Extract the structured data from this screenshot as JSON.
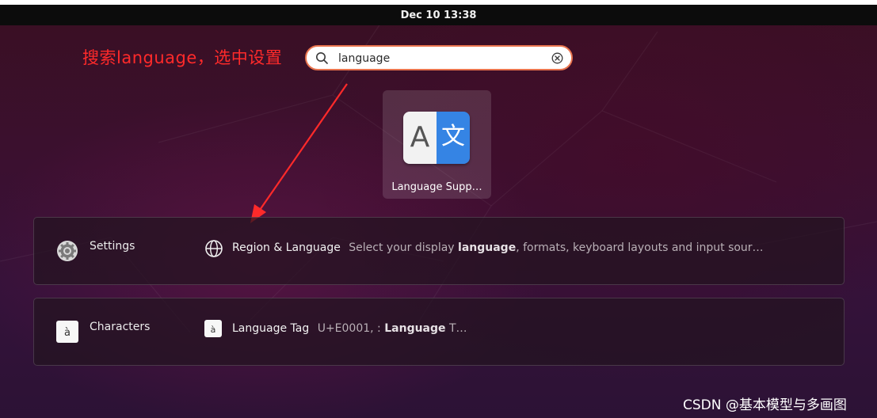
{
  "topbar": {
    "clock": "Dec 10  13:38"
  },
  "annotation": {
    "text": "搜索language，选中设置",
    "color": "#ff2a2a"
  },
  "search": {
    "value": "language",
    "border_color": "#e9744e"
  },
  "apps": [
    {
      "label": "Language Supp…",
      "icon_left_glyph": "A",
      "icon_right_glyph": "文",
      "icon_accent": "#3584e4"
    }
  ],
  "results": [
    {
      "provider": "Settings",
      "provider_icon": "settings-gear-icon",
      "item_icon": "globe-icon",
      "title": "Region & Language",
      "desc_before": "Select your display ",
      "desc_bold": "language",
      "desc_after": ", formats, keyboard layouts and input sour…"
    },
    {
      "provider": "Characters",
      "provider_icon": "characters-app-icon",
      "provider_glyph": "à",
      "item_icon": "character-tile-icon",
      "item_glyph": "à",
      "title": "Language Tag",
      "desc_before": "U+E0001, : ",
      "desc_bold": "Language",
      "desc_after": " T…"
    }
  ],
  "watermark": {
    "text": "CSDN @基本模型与多画图"
  }
}
